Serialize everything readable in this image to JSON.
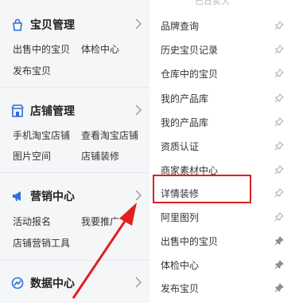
{
  "top_ghost": "已日卖大",
  "groups": [
    {
      "title": "宝贝管理",
      "icon": "bag-icon",
      "links": [
        "出售中的宝贝",
        "体检中心",
        "发布宝贝"
      ]
    },
    {
      "title": "店铺管理",
      "icon": "store-icon",
      "links": [
        "手机淘宝店铺",
        "查看淘宝店铺",
        "图片空间",
        "店铺装修"
      ]
    },
    {
      "title": "营销中心",
      "icon": "megaphone-icon",
      "links": [
        "活动报名",
        "我要推广",
        "店铺营销工具"
      ]
    },
    {
      "title": "数据中心",
      "icon": "chart-icon",
      "links": []
    }
  ],
  "right_items": [
    {
      "label": "品牌查询",
      "pinned": false
    },
    {
      "label": "历史宝贝记录",
      "pinned": false
    },
    {
      "label": "仓库中的宝贝",
      "pinned": false
    },
    {
      "label": "我的产品库",
      "pinned": false
    },
    {
      "label": "我的产品库",
      "pinned": false
    },
    {
      "label": "资质认证",
      "pinned": false
    },
    {
      "label": "商家素材中心",
      "pinned": false
    },
    {
      "label": "详情装修",
      "pinned": false
    },
    {
      "label": "阿里图列",
      "pinned": false
    },
    {
      "label": "出售中的宝贝",
      "pinned": true
    },
    {
      "label": "体检中心",
      "pinned": true
    },
    {
      "label": "发布宝贝",
      "pinned": true
    }
  ],
  "colors": {
    "annotation": "#e02020",
    "accent": "#2f6fdb",
    "sidebar_bg": "#f5f6f8"
  }
}
